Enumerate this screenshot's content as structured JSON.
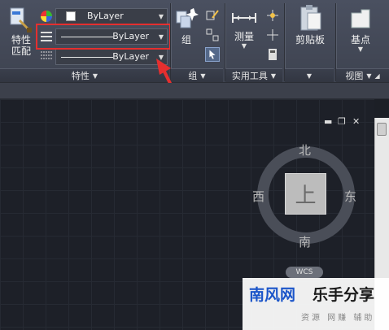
{
  "ribbon": {
    "match_properties": {
      "label_line1": "特性",
      "label_line2": "匹配"
    },
    "color_combo": {
      "value": "ByLayer"
    },
    "linetype_combo": {
      "value": "ByLayer"
    },
    "lineweight_combo": {
      "value": "ByLayer"
    },
    "properties_panel": {
      "title": "特性"
    },
    "group": {
      "label": "组",
      "panel_title": "组"
    },
    "measure": {
      "label": "测量"
    },
    "utilities_panel": {
      "title": "实用工具"
    },
    "clipboard": {
      "label": "剪贴板"
    },
    "base": {
      "label": "基点"
    },
    "view_panel": {
      "title": "视图"
    }
  },
  "viewcube": {
    "north": "北",
    "south": "南",
    "west": "西",
    "east": "东",
    "face": "上",
    "wcs": "WCS"
  },
  "watermark": {
    "brand_a": "南风网",
    "brand_b": "乐手分享",
    "tagline": "资源 网赚 辅助"
  },
  "colors": {
    "highlight": "#e52f2f",
    "ribbon_bg": "#434856",
    "canvas_bg": "#1d2028"
  }
}
